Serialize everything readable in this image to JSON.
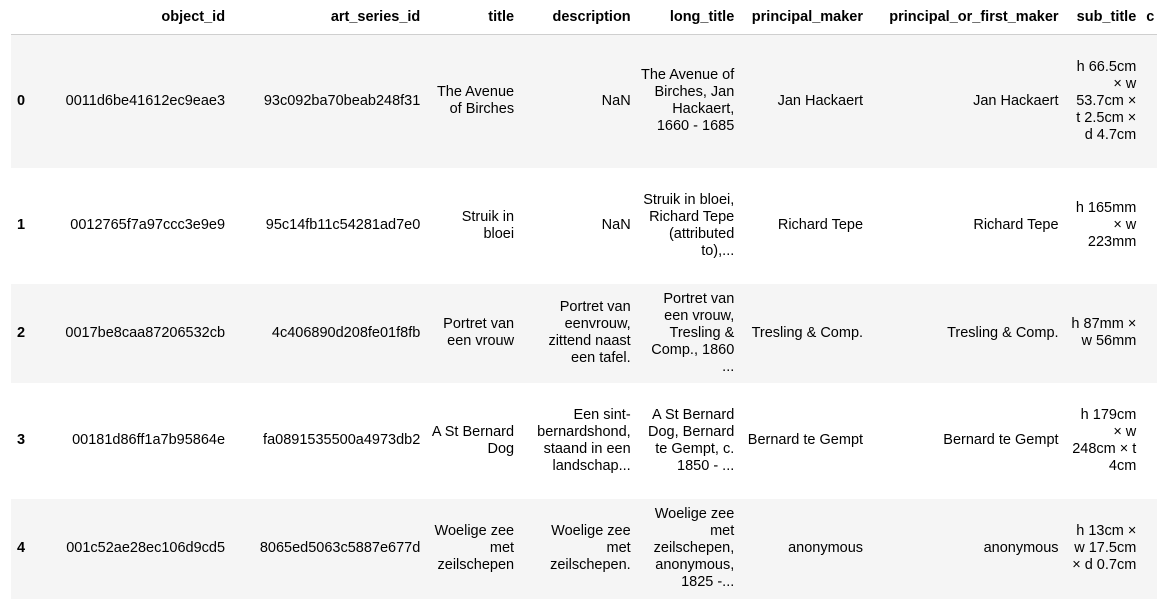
{
  "dataframe": {
    "columns": [
      "",
      "object_id",
      "art_series_id",
      "title",
      "description",
      "long_title",
      "principal_maker",
      "principal_or_first_maker",
      "sub_title",
      "c"
    ],
    "rows": [
      {
        "index": "0",
        "object_id": "0011d6be41612ec9eae3",
        "art_series_id": "93c092ba70beab248f31",
        "title": "The Avenue of Birches",
        "description": "NaN",
        "long_title": "The Avenue of Birches, Jan Hackaert, 1660 - 1685",
        "principal_maker": "Jan Hackaert",
        "principal_or_first_maker": "Jan Hackaert",
        "sub_title": "h 66.5cm × w 53.7cm × t 2.5cm × d 4.7cm"
      },
      {
        "index": "1",
        "object_id": "0012765f7a97ccc3e9e9",
        "art_series_id": "95c14fb11c54281ad7e0",
        "title": "Struik in bloei",
        "description": "NaN",
        "long_title": "Struik in bloei, Richard Tepe (attributed to),...",
        "principal_maker": "Richard Tepe",
        "principal_or_first_maker": "Richard Tepe",
        "sub_title": "h 165mm × w 223mm"
      },
      {
        "index": "2",
        "object_id": "0017be8caa87206532cb",
        "art_series_id": "4c406890d208fe01f8fb",
        "title": "Portret van een vrouw",
        "description": "Portret van eenvrouw, zittend naast een tafel.",
        "long_title": "Portret van een vrouw, Tresling & Comp., 1860 ...",
        "principal_maker": "Tresling & Comp.",
        "principal_or_first_maker": "Tresling & Comp.",
        "sub_title": "h 87mm × w 56mm"
      },
      {
        "index": "3",
        "object_id": "00181d86ff1a7b95864e",
        "art_series_id": "fa0891535500a4973db2",
        "title": "A St Bernard Dog",
        "description": "Een sint-bernardshond, staand in een landschap...",
        "long_title": "A St Bernard Dog, Bernard te Gempt, c. 1850 - ...",
        "principal_maker": "Bernard te Gempt",
        "principal_or_first_maker": "Bernard te Gempt",
        "sub_title": "h 179cm × w 248cm × t 4cm"
      },
      {
        "index": "4",
        "object_id": "001c52ae28ec106d9cd5",
        "art_series_id": "8065ed5063c5887e677d",
        "title": "Woelige zee met zeilschepen",
        "description": "Woelige zee met zeilschepen.",
        "long_title": "Woelige zee met zeilschepen, anonymous, 1825 -...",
        "principal_maker": "anonymous",
        "principal_or_first_maker": "anonymous",
        "sub_title": "h 13cm × w 17.5cm × d 0.7cm"
      }
    ]
  }
}
